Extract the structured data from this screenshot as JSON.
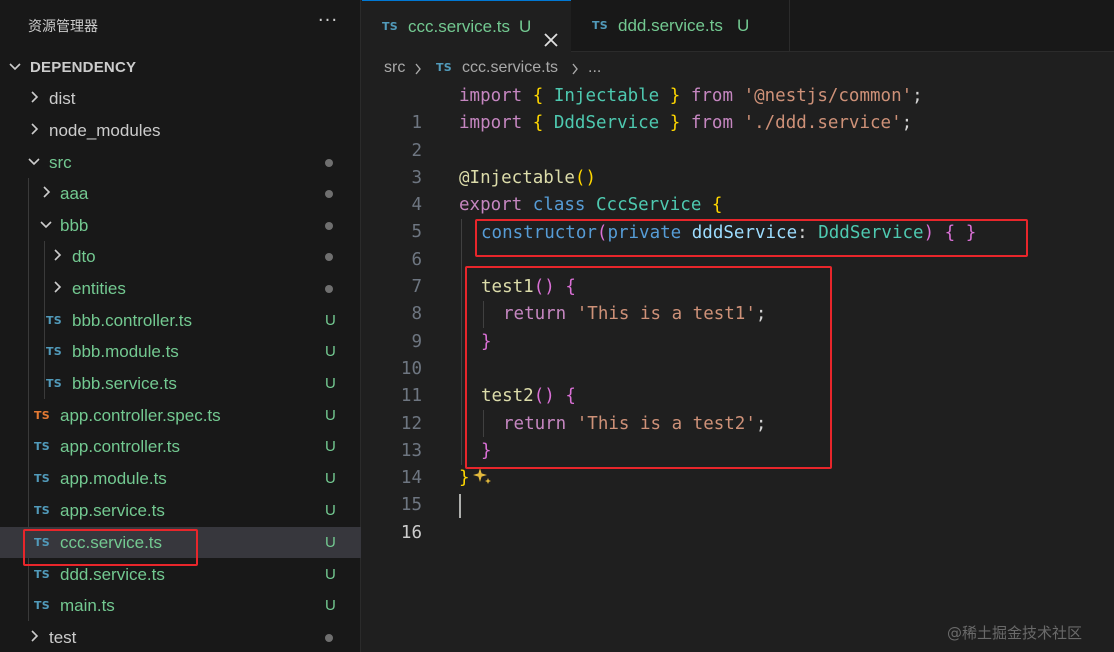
{
  "sidebar": {
    "title": "资源管理器",
    "more_label": "···",
    "section": "DEPENDENCY",
    "items": [
      {
        "label": "dist",
        "kind": "folder",
        "expanded": false
      },
      {
        "label": "node_modules",
        "kind": "folder",
        "expanded": false
      },
      {
        "label": "src",
        "kind": "folder",
        "expanded": true,
        "git": true
      },
      {
        "label": "aaa",
        "kind": "folder",
        "expanded": false,
        "git": true
      },
      {
        "label": "bbb",
        "kind": "folder",
        "expanded": true,
        "git": true
      },
      {
        "label": "dto",
        "kind": "folder",
        "expanded": false,
        "git": true
      },
      {
        "label": "entities",
        "kind": "folder",
        "expanded": false,
        "git": true
      },
      {
        "label": "bbb.controller.ts",
        "icon": "TS",
        "status": "U"
      },
      {
        "label": "bbb.module.ts",
        "icon": "TS",
        "status": "U"
      },
      {
        "label": "bbb.service.ts",
        "icon": "TS",
        "status": "U"
      },
      {
        "label": "app.controller.spec.ts",
        "icon": "TS",
        "status": "U"
      },
      {
        "label": "app.controller.ts",
        "icon": "TS",
        "status": "U"
      },
      {
        "label": "app.module.ts",
        "icon": "TS",
        "status": "U"
      },
      {
        "label": "app.service.ts",
        "icon": "TS",
        "status": "U"
      },
      {
        "label": "ccc.service.ts",
        "icon": "TS",
        "status": "U",
        "selected": true
      },
      {
        "label": "ddd.service.ts",
        "icon": "TS",
        "status": "U"
      },
      {
        "label": "main.ts",
        "icon": "TS",
        "status": "U"
      },
      {
        "label": "test",
        "kind": "folder",
        "expanded": false
      }
    ]
  },
  "tabs": [
    {
      "icon": "TS",
      "label": "ccc.service.ts",
      "status": "U",
      "active": true
    },
    {
      "icon": "TS",
      "label": "ddd.service.ts",
      "status": "U",
      "active": false
    }
  ],
  "breadcrumb": {
    "folder": "src",
    "icon": "TS",
    "file": "ccc.service.ts",
    "more": "..."
  },
  "editor": {
    "line_numbers": [
      "1",
      "2",
      "3",
      "4",
      "5",
      "6",
      "7",
      "8",
      "9",
      "10",
      "11",
      "12",
      "13",
      "14",
      "15",
      "16"
    ],
    "code": {
      "l1": {
        "import": "import",
        "open": "{",
        "name": "Injectable",
        "close": "}",
        "from": "from",
        "path": "'@nestjs/common'",
        "semi": ";"
      },
      "l2": {
        "import": "import",
        "open": "{",
        "name": "DddService",
        "close": "}",
        "from": "from",
        "path": "'./ddd.service'",
        "semi": ";"
      },
      "l4": {
        "at": "@Injectable",
        "paren": "()"
      },
      "l5": {
        "export": "export",
        "cls": "class",
        "name": "CccService",
        "open": "{"
      },
      "l6": {
        "ctor": "constructor",
        "popen": "(",
        "private": "private",
        "param": "dddService",
        "colon": ":",
        "type": "DddService",
        "pclose": ")",
        "body": "{ }"
      },
      "l8": {
        "name": "test1",
        "paren": "()",
        "open": "{"
      },
      "l9": {
        "ret": "return",
        "str": "'This is a test1'",
        "semi": ";"
      },
      "l10": {
        "close": "}"
      },
      "l12": {
        "name": "test2",
        "paren": "()",
        "open": "{"
      },
      "l13": {
        "ret": "return",
        "str": "'This is a test2'",
        "semi": ";"
      },
      "l14": {
        "close": "}"
      },
      "l15": {
        "close": "}"
      }
    }
  },
  "watermark": "@稀土掘金技术社区",
  "colors": {
    "highlight_box": "#e8262b",
    "git_untracked": "#73c991",
    "ts_icon": "#519aba",
    "accent": "#0078d4"
  }
}
